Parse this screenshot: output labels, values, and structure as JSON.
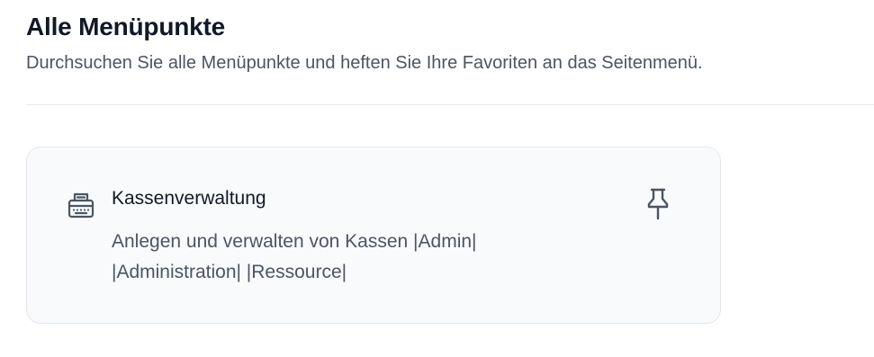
{
  "header": {
    "title": "Alle Menüpunkte",
    "subtitle": "Durchsuchen Sie alle Menüpunkte und heften Sie Ihre Favoriten an das Seitenmenü."
  },
  "items": [
    {
      "title": "Kassenverwaltung",
      "description": "Anlegen und verwalten von Kassen |Admin| |Administration| |Ressource|",
      "icon": "cash-register-icon",
      "pin_icon": "pin-icon",
      "pinned": false
    }
  ],
  "colors": {
    "text_primary": "#111827",
    "text_secondary": "#4b5563",
    "card_background": "#f8fafc",
    "border": "#e5e7eb"
  }
}
